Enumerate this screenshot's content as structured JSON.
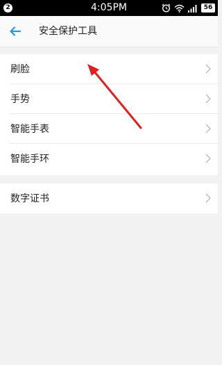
{
  "status_bar": {
    "notification_count": "2",
    "time": "4:05PM",
    "battery_level": "56",
    "icons": [
      "alarm-icon",
      "wifi-icon",
      "signal-icon",
      "battery-icon"
    ]
  },
  "header": {
    "back_icon": "back-arrow-icon",
    "title": "安全保护工具"
  },
  "menu_group_1": {
    "items": [
      {
        "label": "刷脸",
        "icon": "chevron-right-icon"
      },
      {
        "label": "手势",
        "icon": "chevron-right-icon"
      },
      {
        "label": "智能手表",
        "icon": "chevron-right-icon"
      },
      {
        "label": "智能手环",
        "icon": "chevron-right-icon"
      }
    ]
  },
  "menu_group_2": {
    "items": [
      {
        "label": "数字证书",
        "icon": "chevron-right-icon"
      }
    ]
  },
  "colors": {
    "accent": "#1c9be6",
    "annotation_arrow": "#e02020",
    "background": "#f2f2f2"
  }
}
